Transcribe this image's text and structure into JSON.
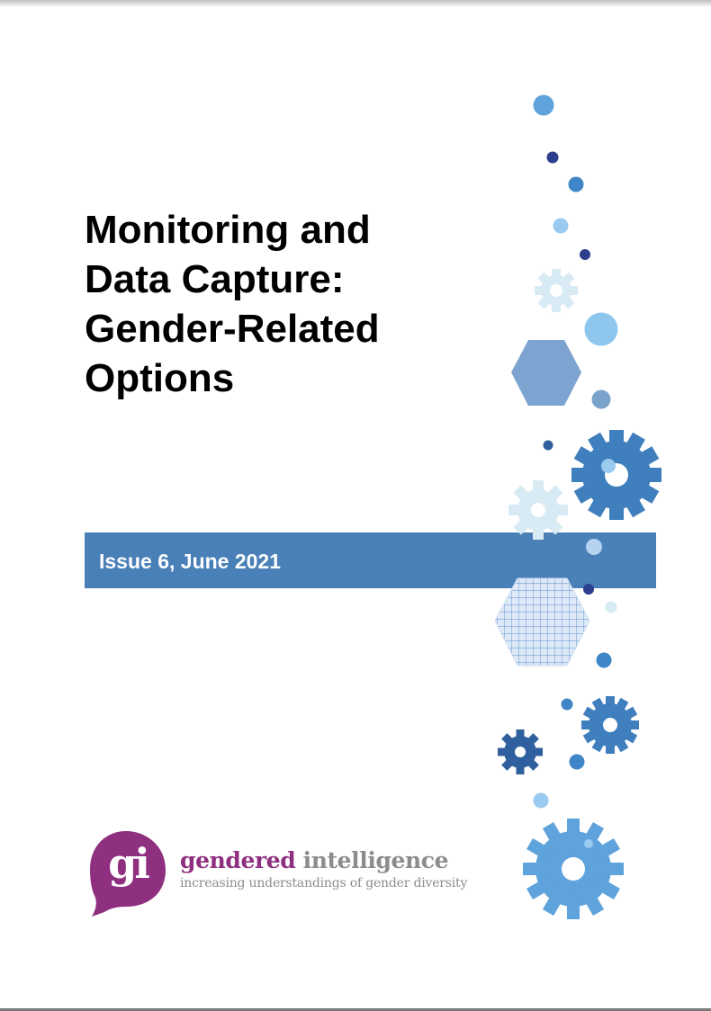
{
  "document": {
    "title_lines": [
      "Monitoring and",
      "Data Capture:",
      "Gender-Related",
      "Options"
    ],
    "issue": "Issue 6, June 2021"
  },
  "logo": {
    "mark": "gi",
    "name_first": "gendered",
    "name_second": "intelligence",
    "tagline": "increasing understandings of gender diversity"
  },
  "decoration": {
    "icons": [
      "gear-icon",
      "hexagon-shape",
      "circle-dot"
    ]
  },
  "colors": {
    "band": "#4a80b8",
    "brand_purple": "#8f2f80",
    "brand_grey": "#8c8c8c",
    "blue_dark": "#2f5f9e",
    "blue_mid": "#3f86c8",
    "blue_light": "#9bcaf0",
    "blue_pale": "#d8eaf3",
    "navy": "#2b3f8c"
  }
}
